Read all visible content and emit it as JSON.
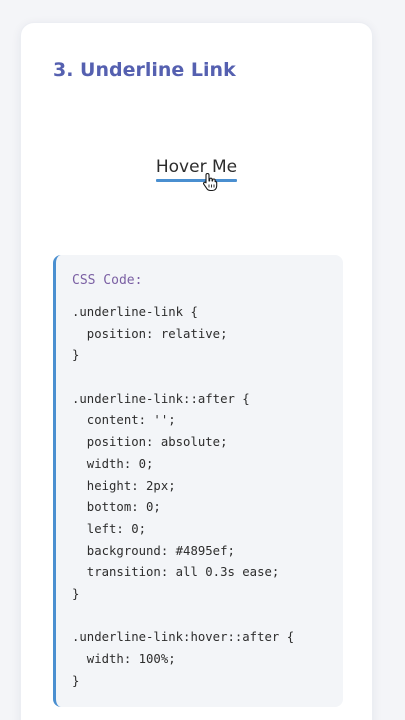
{
  "card": {
    "title": "3. Underline Link"
  },
  "demo": {
    "link_label": "Hover Me",
    "underline_fill_percent": 100,
    "underline_color": "#4895ef",
    "cursor": "hand-pointer-icon"
  },
  "code": {
    "label": "CSS Code:",
    "lines": [
      ".underline-link {",
      "  position: relative;",
      "}",
      "",
      ".underline-link::after {",
      "  content: '';",
      "  position: absolute;",
      "  width: 0;",
      "  height: 2px;",
      "  bottom: 0;",
      "  left: 0;",
      "  background: #4895ef;",
      "  transition: all 0.3s ease;",
      "}",
      "",
      ".underline-link:hover::after {",
      "  width: 100%;",
      "}"
    ]
  },
  "colors": {
    "title": "#5560b0",
    "accent": "#4a8fd0",
    "code_label": "#7a5fa3",
    "code_bg": "#f3f5f8"
  }
}
